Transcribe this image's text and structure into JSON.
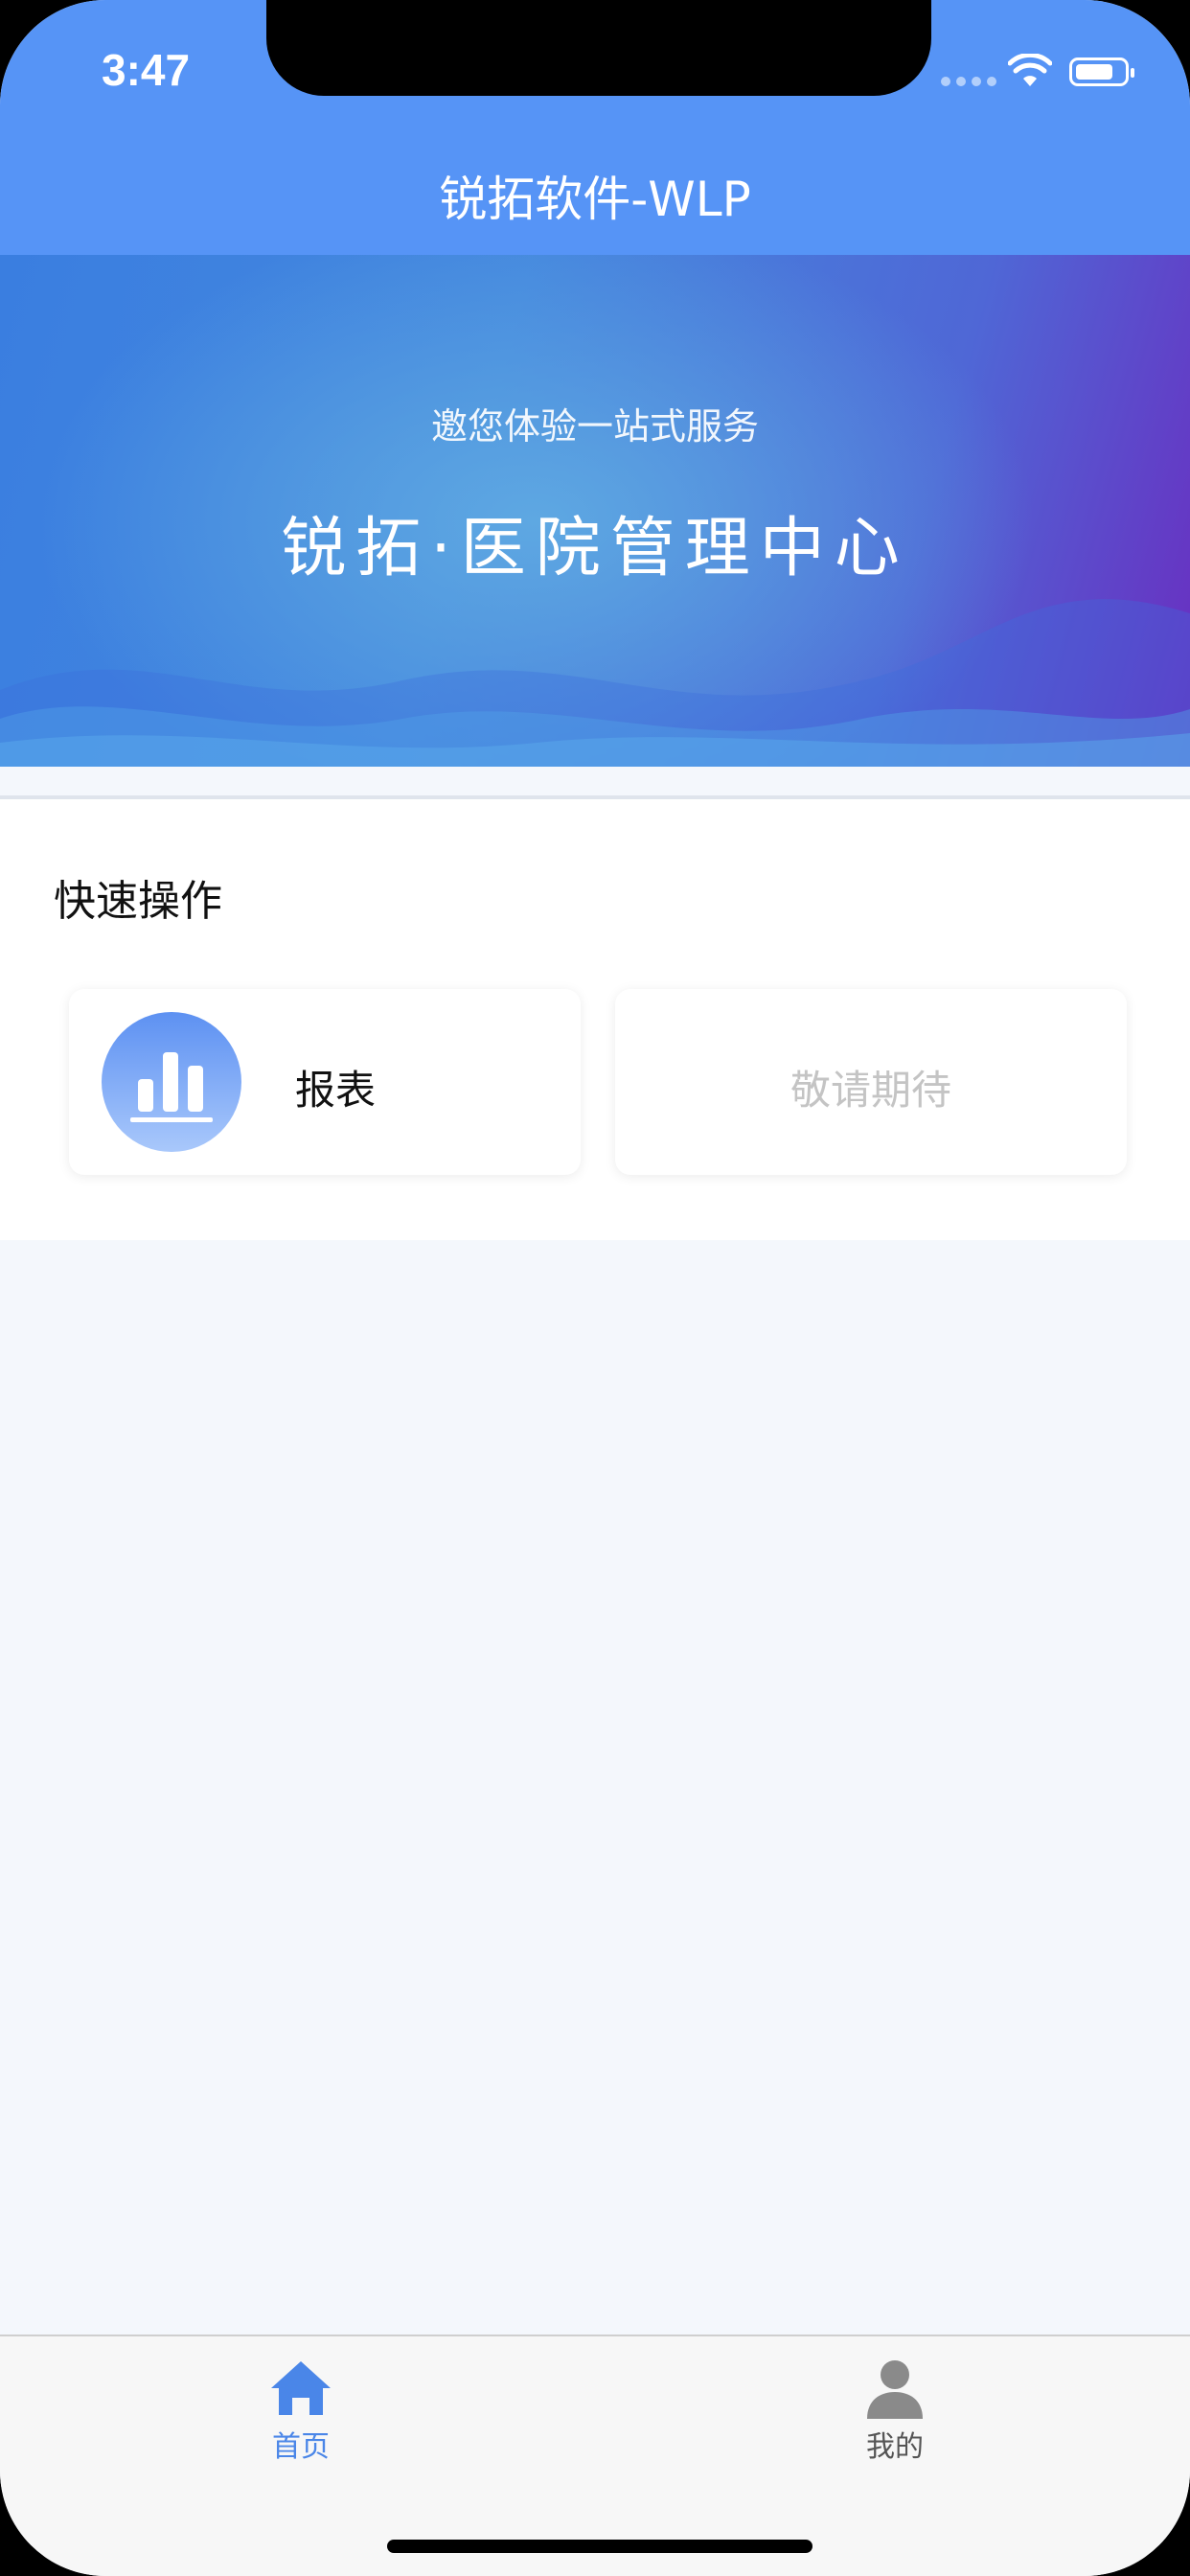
{
  "status_bar": {
    "time": "3:47"
  },
  "nav": {
    "title": "锐拓软件-WLP"
  },
  "banner": {
    "subtitle": "邀您体验一站式服务",
    "title": "锐拓·医院管理中心"
  },
  "quick_actions": {
    "title": "快速操作",
    "items": [
      {
        "label": "报表",
        "icon": "bar-chart-icon"
      },
      {
        "label": "敬请期待"
      }
    ]
  },
  "tabbar": {
    "tabs": [
      {
        "label": "首页",
        "icon": "home-icon",
        "active": true
      },
      {
        "label": "我的",
        "icon": "user-icon",
        "active": false
      }
    ],
    "active_color": "#4a86e8"
  },
  "colors": {
    "primary": "#5694f6",
    "banner_gradient_start": "#3a7ee0",
    "banner_gradient_end": "#6a2dc0",
    "page_background": "#f4f7fc"
  }
}
